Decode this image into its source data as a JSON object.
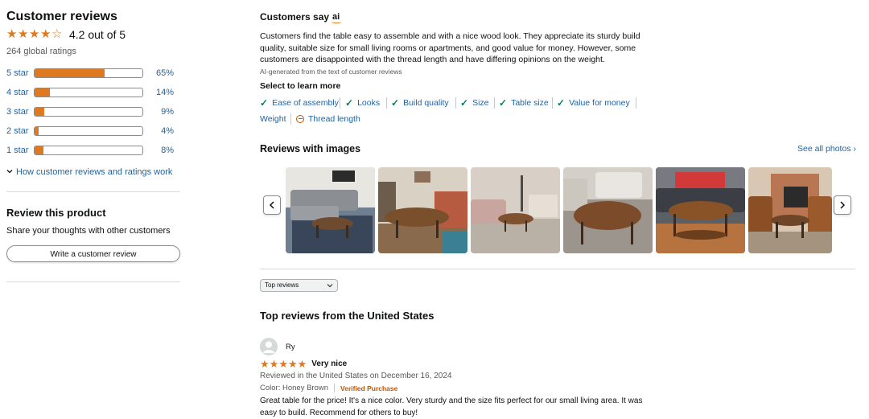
{
  "summary": {
    "title": "Customer reviews",
    "rating": 4.2,
    "rating_text": "4.2 out of 5",
    "global_ratings": "264 global ratings",
    "accent_color": "#de7921",
    "link_color": "#2162a1",
    "histogram": [
      {
        "label": "5 star",
        "pct_text": "65%",
        "pct": 65
      },
      {
        "label": "4 star",
        "pct_text": "14%",
        "pct": 14
      },
      {
        "label": "3 star",
        "pct_text": "9%",
        "pct": 9
      },
      {
        "label": "2 star",
        "pct_text": "4%",
        "pct": 4
      },
      {
        "label": "1 star",
        "pct_text": "8%",
        "pct": 8
      }
    ],
    "how_link": "How customer reviews and ratings work"
  },
  "review_product": {
    "title": "Review this product",
    "subtitle": "Share your thoughts with other customers",
    "button": "Write a customer review"
  },
  "customers_say": {
    "title": "Customers say",
    "ai_badge": "ai",
    "summary": "Customers find the table easy to assemble and with a nice wood look. They appreciate its sturdy build quality, suitable size for small living rooms or apartments, and good value for money. However, some customers are disappointed with the thread length and have differing opinions on the weight.",
    "ai_note": "AI-generated from the text of customer reviews",
    "select_title": "Select to learn more",
    "aspects": [
      {
        "label": "Ease of assembly",
        "sentiment": "positive"
      },
      {
        "label": "Looks",
        "sentiment": "positive"
      },
      {
        "label": "Build quality",
        "sentiment": "positive"
      },
      {
        "label": "Size",
        "sentiment": "positive"
      },
      {
        "label": "Table size",
        "sentiment": "positive"
      },
      {
        "label": "Value for money",
        "sentiment": "positive"
      },
      {
        "label": "Weight",
        "sentiment": "mixed"
      },
      {
        "label": "Thread length",
        "sentiment": "negative"
      }
    ]
  },
  "reviews_with_images": {
    "title": "Reviews with images",
    "see_all": "See all photos ›",
    "prev_icon": "chevron-left-icon",
    "next_icon": "chevron-right-icon",
    "photo_count": 6
  },
  "sort": {
    "selected": "Top reviews"
  },
  "top_reviews": {
    "title": "Top reviews from the United States",
    "reviews": [
      {
        "author": "Ry",
        "stars": 5,
        "title": "Very nice",
        "date": "Reviewed in the United States on December 16, 2024",
        "variant": "Color: Honey Brown",
        "verified": "Verified Purchase",
        "body": "Great table for the price! It's a nice color. Very sturdy and the size fits perfect for our small living area. It was easy to build. Recommend for others to buy!"
      }
    ]
  }
}
